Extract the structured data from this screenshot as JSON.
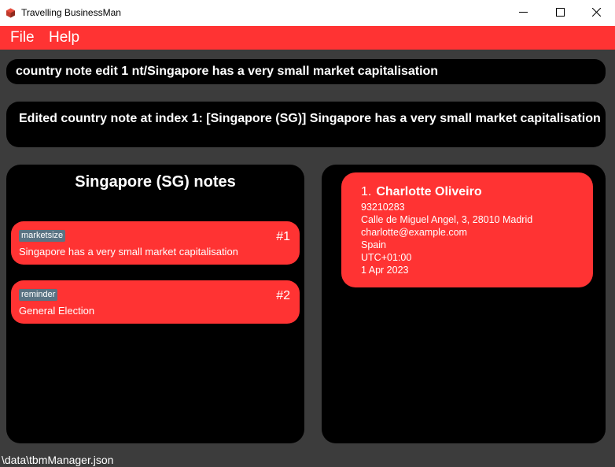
{
  "window": {
    "title": "Travelling BusinessMan",
    "app_icon": "cube-icon",
    "controls": [
      "minimize-icon",
      "maximize-icon",
      "close-icon"
    ]
  },
  "menu": {
    "file_label": "File",
    "help_label": "Help"
  },
  "command": {
    "value": "country note edit 1 nt/Singapore has a very small market capitalisation"
  },
  "result": {
    "text": "Edited country note at index 1: [Singapore (SG)] Singapore has a very small market capitalisation"
  },
  "notes": {
    "title": "Singapore (SG) notes",
    "items": [
      {
        "tag": "marketsize",
        "index": "#1",
        "text": "Singapore has a very small market capitalisation"
      },
      {
        "tag": "reminder",
        "index": "#2",
        "text": "General Election"
      }
    ]
  },
  "contacts": [
    {
      "index": "1.",
      "name": "Charlotte Oliveiro",
      "phone": "93210283",
      "address": "Calle de Miguel Angel, 3, 28010 Madrid",
      "email": "charlotte@example.com",
      "country": "Spain",
      "timezone": "UTC+01:00",
      "date": "1 Apr 2023"
    }
  ],
  "status": {
    "path": "\\data\\tbmManager.json"
  },
  "colors": {
    "accent": "#ff3333",
    "panel": "#000000",
    "background": "#3c3c3c",
    "tag": "#5a7383"
  }
}
